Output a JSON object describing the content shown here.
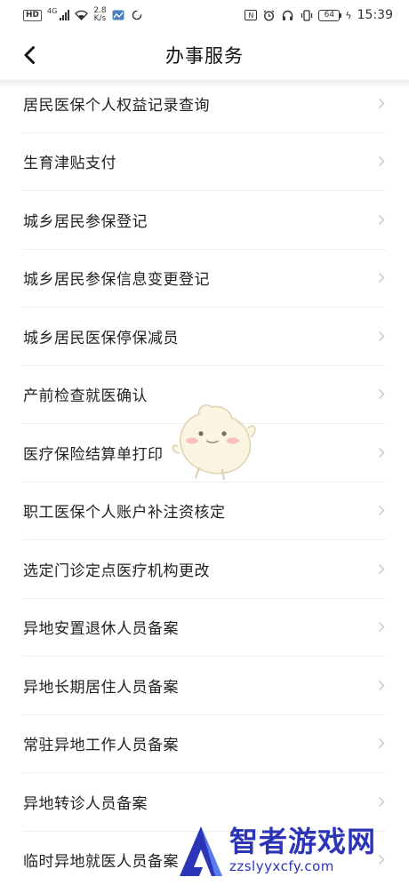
{
  "statusbar": {
    "hd": "HD",
    "net": "4G",
    "speed_value": "2.8",
    "speed_unit": "K/s",
    "battery": "64",
    "time": "15:39"
  },
  "header": {
    "title": "办事服务"
  },
  "list": {
    "items": [
      {
        "label": "居民医保个人权益记录查询"
      },
      {
        "label": "生育津贴支付"
      },
      {
        "label": "城乡居民参保登记"
      },
      {
        "label": "城乡居民参保信息变更登记"
      },
      {
        "label": "城乡居民医保停保减员"
      },
      {
        "label": "产前检查就医确认"
      },
      {
        "label": "医疗保险结算单打印"
      },
      {
        "label": "职工医保个人账户补注资核定"
      },
      {
        "label": "选定门诊定点医疗机构更改"
      },
      {
        "label": "异地安置退休人员备案"
      },
      {
        "label": "异地长期居住人员备案"
      },
      {
        "label": "常驻异地工作人员备案"
      },
      {
        "label": "异地转诊人员备案"
      },
      {
        "label": "临时异地就医人员备案"
      }
    ]
  },
  "watermark": {
    "name": "智者游戏网",
    "url": "zzslyyxcfy.com"
  },
  "colors": {
    "accent": "#2c34b8",
    "divider": "#eeeeee",
    "chevron": "#c8c8c8"
  }
}
